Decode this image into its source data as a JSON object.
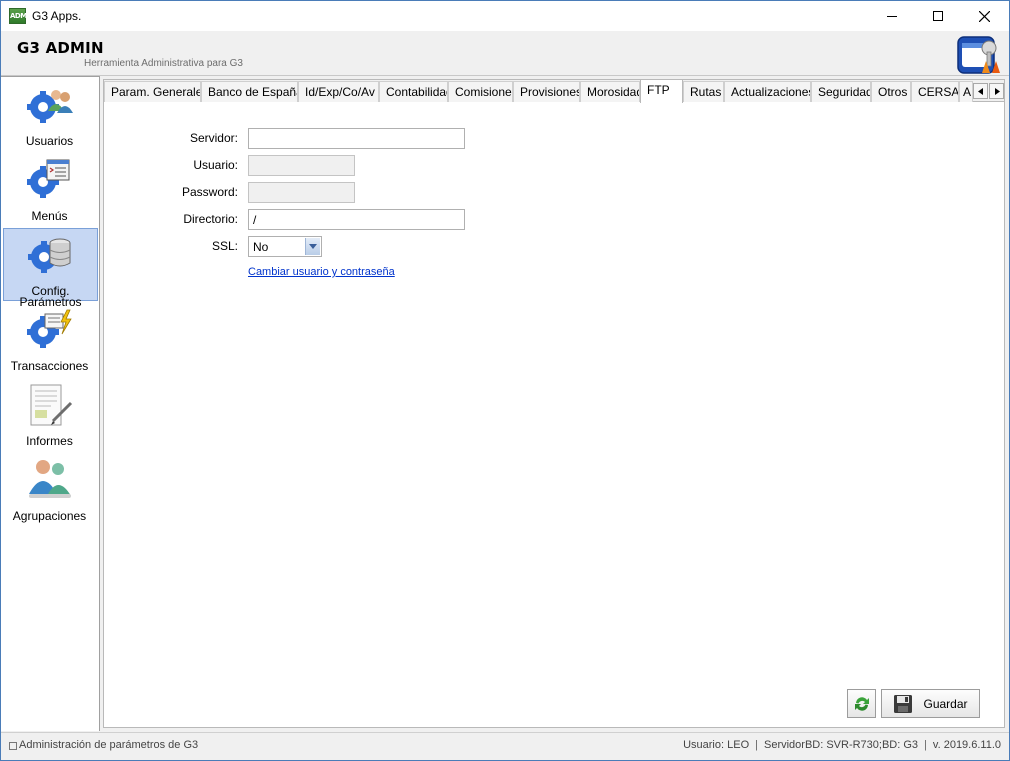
{
  "window": {
    "title": "G3 Apps.",
    "icon_text": "ADM"
  },
  "header": {
    "title": "G3 ADMIN",
    "subtitle": "Herramienta Administrativa para G3"
  },
  "nav": {
    "items": [
      {
        "label": "Usuarios",
        "icon": "users-gear-icon",
        "selected": false
      },
      {
        "label": "Menús",
        "icon": "menu-gear-icon",
        "selected": false
      },
      {
        "label": "Config. Parámetros",
        "icon": "database-gear-icon",
        "selected": true
      },
      {
        "label": "Transacciones",
        "icon": "transaction-gear-icon",
        "selected": false
      },
      {
        "label": "Informes",
        "icon": "report-document-icon",
        "selected": false
      },
      {
        "label": "Agrupaciones",
        "icon": "group-users-icon",
        "selected": false
      }
    ]
  },
  "tabs": [
    "Param. Generales",
    "Banco de España",
    "Id/Exp/Co/Av",
    "Contabilidad",
    "Comisiones",
    "Provisiones",
    "Morosidad",
    "FTP",
    "Rutas",
    "Actualizaciones",
    "Seguridad",
    "Otros",
    "CERSA",
    "A"
  ],
  "active_tab": "FTP",
  "form": {
    "servidor_label": "Servidor:",
    "servidor_value": "",
    "usuario_label": "Usuario:",
    "usuario_value": "",
    "password_label": "Password:",
    "password_value": "",
    "directorio_label": "Directorio:",
    "directorio_value": "/",
    "ssl_label": "SSL:",
    "ssl_value": "No",
    "change_link": "Cambiar usuario y contraseña"
  },
  "buttons": {
    "save_label": "Guardar"
  },
  "status": {
    "left": "Administración de parámetros de G3",
    "user": "Usuario: LEO",
    "server": "ServidorBD: SVR-R730;BD: G3",
    "version": "v. 2019.6.11.0"
  },
  "colors": {
    "accent_selected": "#c6d7f3",
    "link": "#0033cc",
    "window_border": "#4a7cb8"
  }
}
